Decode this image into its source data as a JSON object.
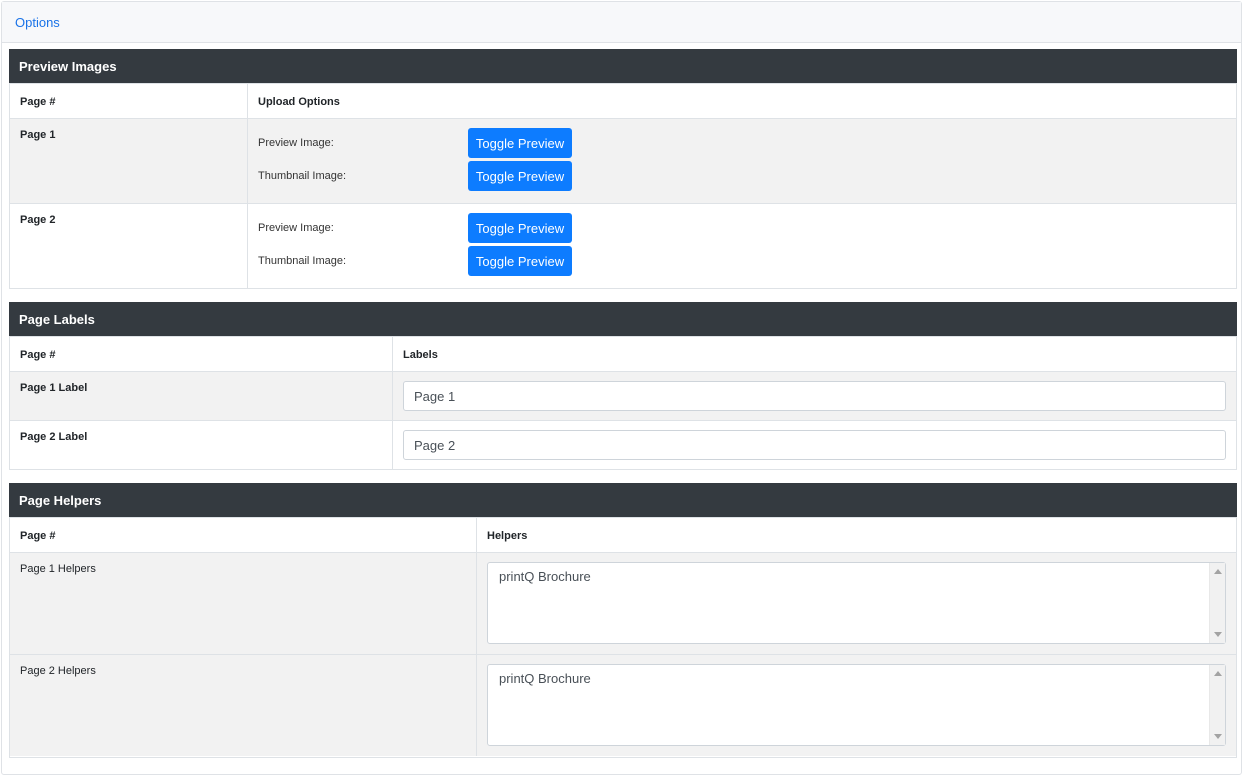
{
  "header": {
    "title": "Options"
  },
  "preview_images": {
    "title": "Preview Images",
    "col_page": "Page #",
    "col_upload": "Upload Options",
    "rows": [
      {
        "page": "Page 1",
        "preview_label": "Preview Image:",
        "thumbnail_label": "Thumbnail Image:",
        "preview_button": "Toggle Preview",
        "thumbnail_button": "Toggle Preview"
      },
      {
        "page": "Page 2",
        "preview_label": "Preview Image:",
        "thumbnail_label": "Thumbnail Image:",
        "preview_button": "Toggle Preview",
        "thumbnail_button": "Toggle Preview"
      }
    ]
  },
  "page_labels": {
    "title": "Page Labels",
    "col_page": "Page #",
    "col_labels": "Labels",
    "rows": [
      {
        "page": "Page 1 Label",
        "value": "Page 1"
      },
      {
        "page": "Page 2 Label",
        "value": "Page 2"
      }
    ]
  },
  "page_helpers": {
    "title": "Page Helpers",
    "col_page": "Page #",
    "col_helpers": "Helpers",
    "rows": [
      {
        "page": "Page 1 Helpers",
        "value": "printQ Brochure"
      },
      {
        "page": "Page 2 Helpers",
        "value": "printQ Brochure"
      }
    ]
  },
  "colors": {
    "section_header_bg": "#343a40",
    "button_bg": "#0d7cff",
    "link": "#1a73e8",
    "shaded_row": "#f2f2f2"
  }
}
